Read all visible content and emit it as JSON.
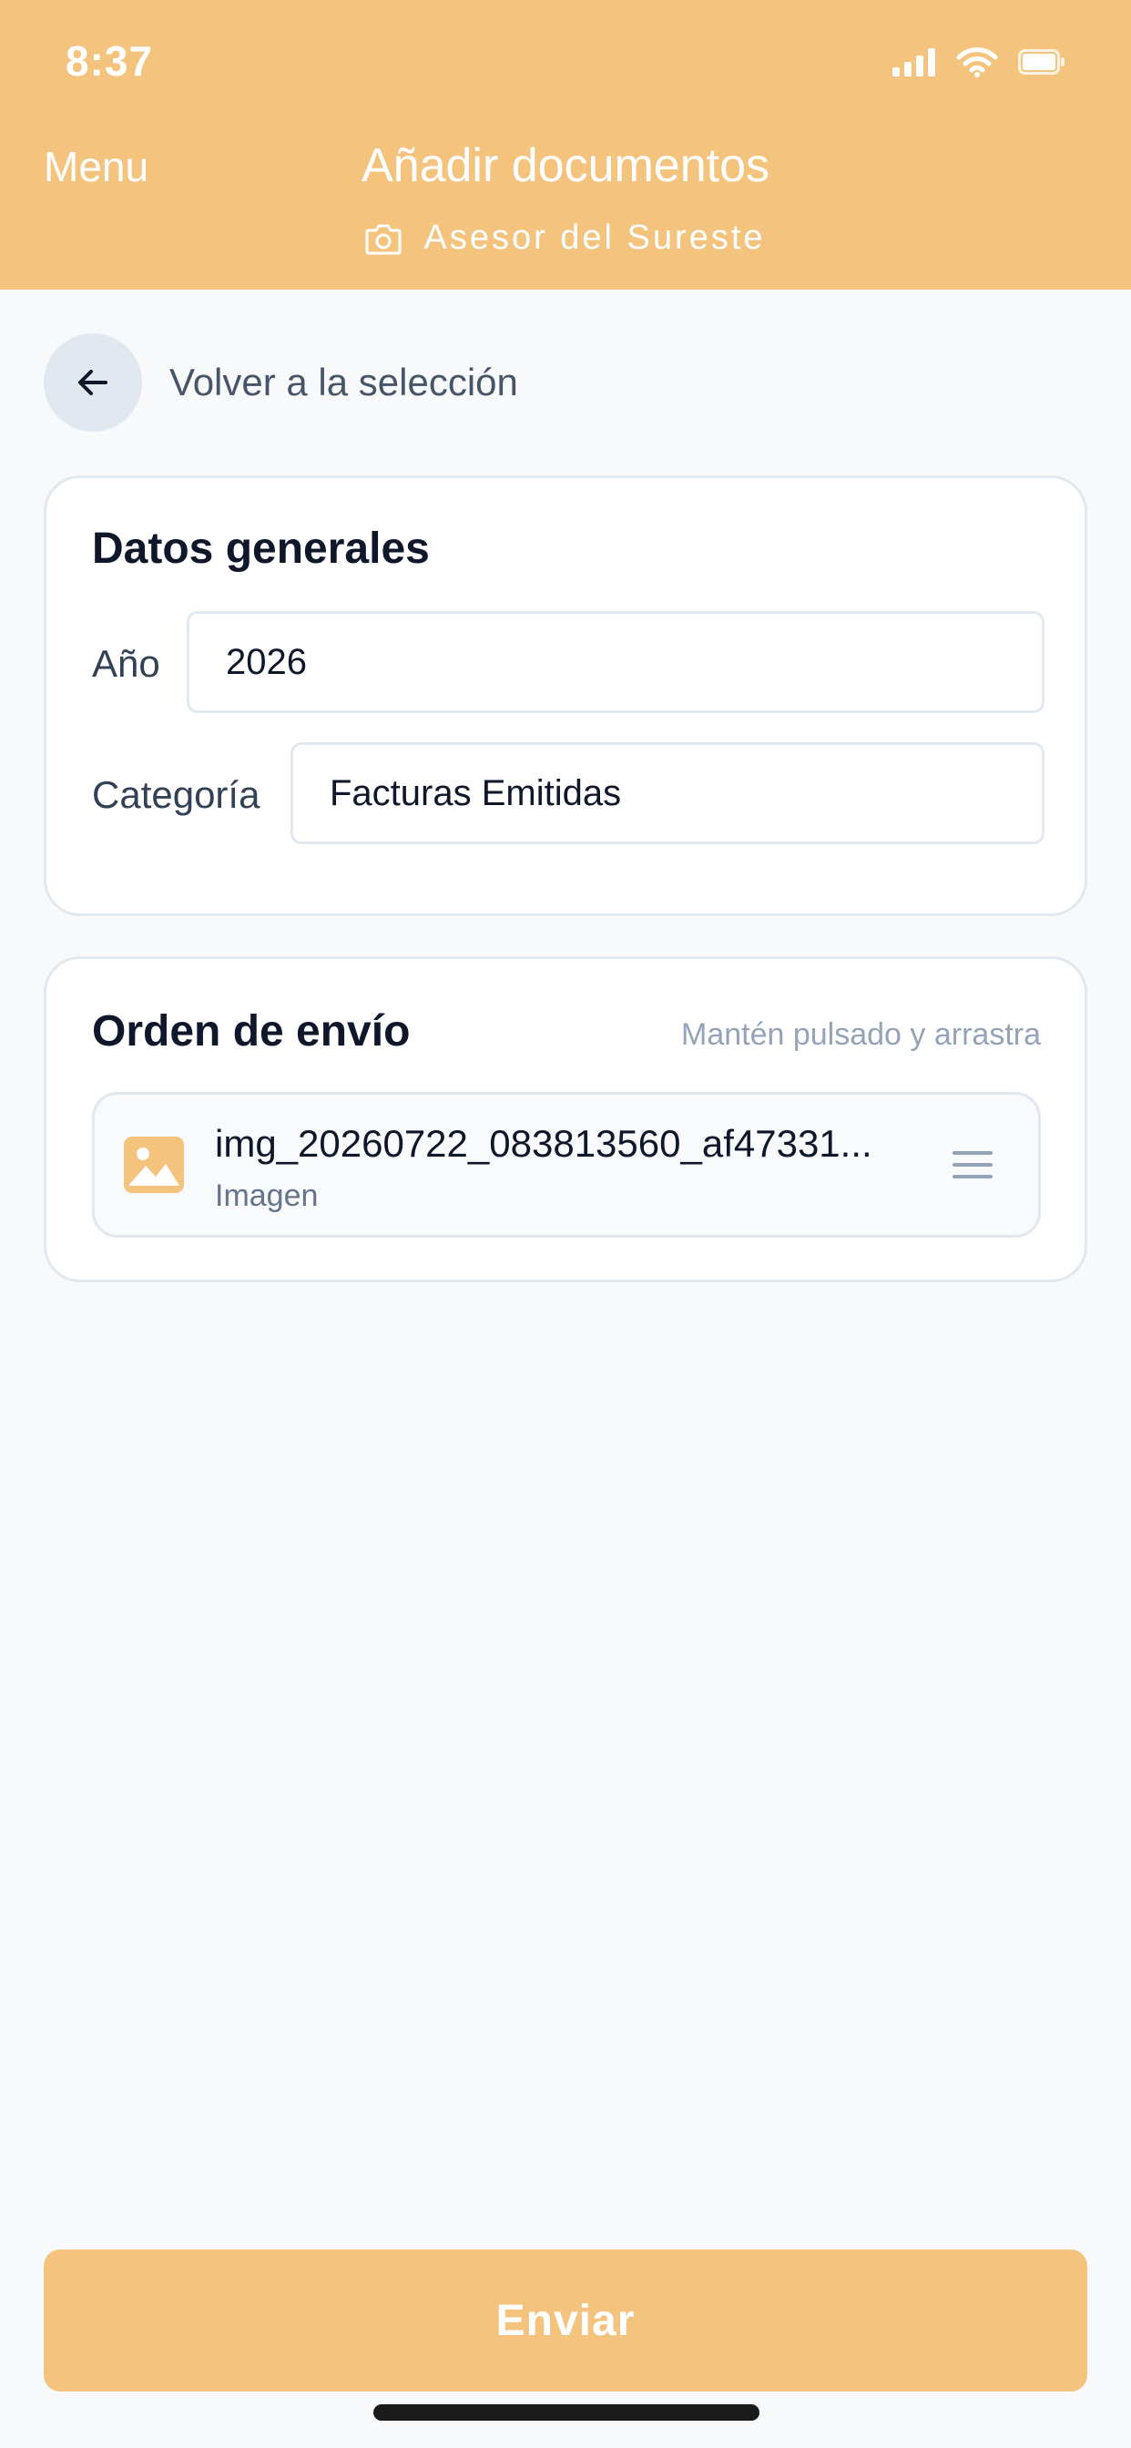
{
  "status_bar": {
    "time": "8:37",
    "icons": [
      "signal-icon",
      "wifi-icon",
      "battery-icon"
    ]
  },
  "header": {
    "menu_label": "Menu",
    "title": "Añadir documentos",
    "subtitle": "Asesor del Sureste",
    "subtitle_icon": "camera-icon",
    "background_color": "#f4c47f"
  },
  "back": {
    "icon": "arrow-left-icon",
    "label": "Volver a la selección"
  },
  "general": {
    "title": "Datos generales",
    "year_label": "Año",
    "year_value": "2026",
    "category_label": "Categoría",
    "category_value": "Facturas Emitidas"
  },
  "order": {
    "title": "Orden de envío",
    "hint": "Mantén pulsado y arrastra",
    "files": [
      {
        "name": "img_20260722_083813560_af47331...",
        "type": "Imagen",
        "icon": "image-icon",
        "handle_icon": "drag-handle-icon"
      }
    ]
  },
  "actions": {
    "send_label": "Enviar"
  }
}
